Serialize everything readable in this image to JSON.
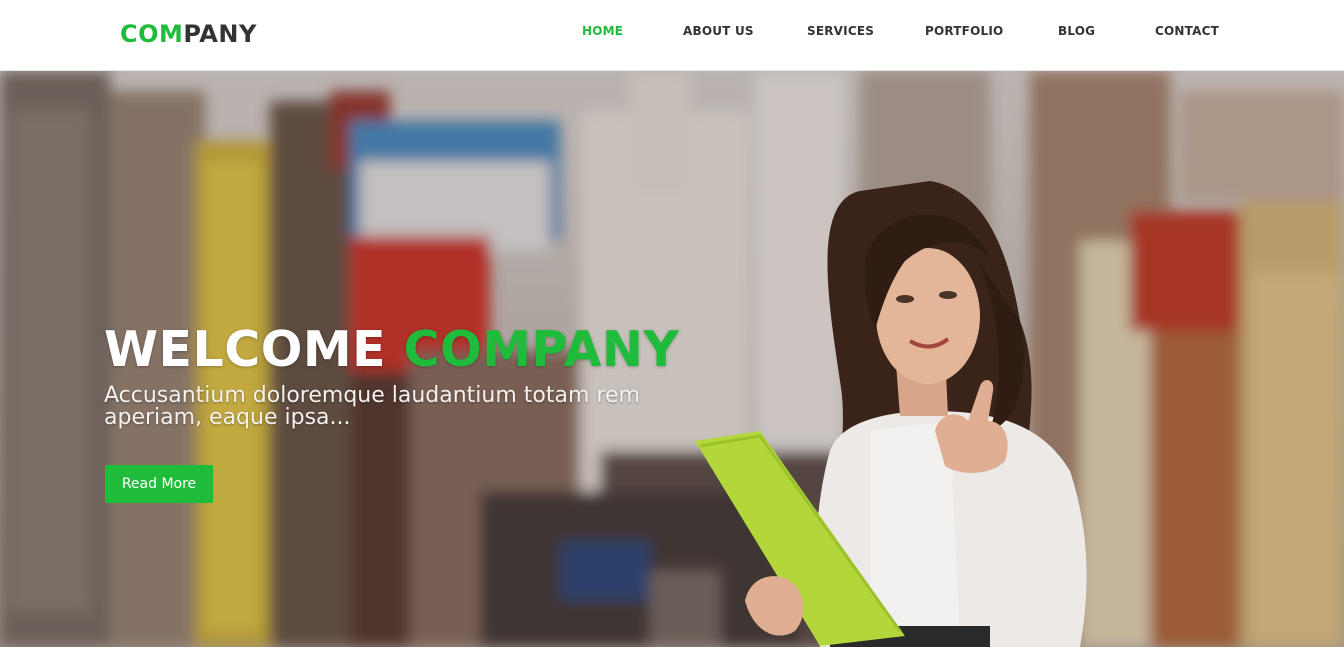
{
  "brand": {
    "logo_part1": "COM",
    "logo_part2": "PANY"
  },
  "nav": {
    "items": [
      {
        "label": "HOME",
        "active": true
      },
      {
        "label": "ABOUT US",
        "active": false
      },
      {
        "label": "SERVICES",
        "active": false
      },
      {
        "label": "PORTFOLIO",
        "active": false
      },
      {
        "label": "BLOG",
        "active": false
      },
      {
        "label": "CONTACT",
        "active": false
      }
    ]
  },
  "hero": {
    "title_part1": "WELCOME",
    "title_part2": "COMPANY",
    "subtitle": "Accusantium doloremque laudantium totam rem aperiam, eaque ipsa...",
    "button_label": "Read More"
  },
  "colors": {
    "accent": "#1fbb3a",
    "text_dark": "#333333",
    "white": "#ffffff"
  },
  "icons": {
    "hero_image": "woman-holding-folder-thumbs-up-photo"
  }
}
